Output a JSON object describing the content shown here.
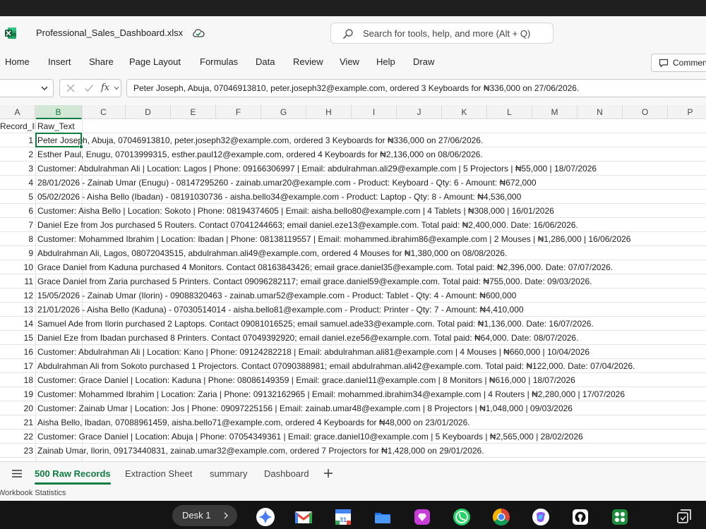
{
  "app": {
    "filename": "Professional_Sales_Dashboard.xlsx",
    "search_placeholder": "Search for tools, help, and more (Alt + Q)"
  },
  "ribbon": {
    "tabs": [
      "Home",
      "Insert",
      "Share",
      "Page Layout",
      "Formulas",
      "Data",
      "Review",
      "View",
      "Help",
      "Draw"
    ],
    "comments_label": "Comments"
  },
  "formula_bar": {
    "fx_label": "fx",
    "value": "Peter Joseph, Abuja, 07046913810, peter.joseph32@example.com, ordered 3 Keyboards for ₦336,000 on 27/06/2026."
  },
  "grid": {
    "columns": [
      "A",
      "B",
      "C",
      "D",
      "E",
      "F",
      "G",
      "H",
      "I",
      "J",
      "K",
      "L",
      "M",
      "N",
      "O",
      "P"
    ],
    "selected_column": "B",
    "active_cell": "B2",
    "header_row": {
      "a": "Record_ID",
      "b": "Raw_Text"
    },
    "rows": [
      {
        "id": "1",
        "text": "Peter Joseph, Abuja, 07046913810, peter.joseph32@example.com, ordered 3 Keyboards for ₦336,000 on 27/06/2026."
      },
      {
        "id": "2",
        "text": "Esther Paul, Enugu, 07013999315, esther.paul12@example.com, ordered 4 Keyboards for ₦2,136,000 on 08/06/2026."
      },
      {
        "id": "3",
        "text": "Customer: Abdulrahman Ali | Location: Lagos | Phone: 09166306997 | Email: abdulrahman.ali29@example.com | 5 Projectors | ₦55,000 | 18/07/2026"
      },
      {
        "id": "4",
        "text": "28/01/2026 - Zainab Umar (Enugu) - 08147295260 - zainab.umar20@example.com - Product: Keyboard - Qty: 6 - Amount: ₦672,000"
      },
      {
        "id": "5",
        "text": "05/02/2026 - Aisha Bello (Ibadan) - 08191030736 - aisha.bello34@example.com - Product: Laptop - Qty: 8 - Amount: ₦4,536,000"
      },
      {
        "id": "6",
        "text": "Customer: Aisha Bello | Location: Sokoto | Phone: 08194374605 | Email: aisha.bello80@example.com | 4 Tablets | ₦308,000 | 16/01/2026"
      },
      {
        "id": "7",
        "text": "Daniel Eze from Jos purchased 5 Routers. Contact 07041244663; email daniel.eze13@example.com. Total paid: ₦2,400,000. Date: 16/06/2026."
      },
      {
        "id": "8",
        "text": "Customer: Mohammed Ibrahim | Location: Ibadan | Phone: 08138119557 | Email: mohammed.ibrahim86@example.com | 2 Mouses | ₦1,286,000 | 16/06/2026"
      },
      {
        "id": "9",
        "text": "Abdulrahman Ali, Lagos, 08072043515, abdulrahman.ali49@example.com, ordered 4 Mouses for ₦1,380,000 on 08/08/2026."
      },
      {
        "id": "10",
        "text": "Grace Daniel from Kaduna purchased 4 Monitors. Contact 08163843426; email grace.daniel35@example.com. Total paid: ₦2,396,000. Date: 07/07/2026."
      },
      {
        "id": "11",
        "text": "Grace Daniel from Zaria purchased 5 Printers. Contact 09096282117; email grace.daniel59@example.com. Total paid: ₦755,000. Date: 09/03/2026."
      },
      {
        "id": "12",
        "text": "15/05/2026 - Zainab Umar (Ilorin) - 09088320463 - zainab.umar52@example.com - Product: Tablet - Qty: 4 - Amount: ₦600,000"
      },
      {
        "id": "13",
        "text": "21/01/2026 - Aisha Bello (Kaduna) - 07030514014 - aisha.bello81@example.com - Product: Printer - Qty: 7 - Amount: ₦4,410,000"
      },
      {
        "id": "14",
        "text": "Samuel Ade from Ilorin purchased 2 Laptops. Contact 09081016525; email samuel.ade33@example.com. Total paid: ₦1,136,000. Date: 16/07/2026."
      },
      {
        "id": "15",
        "text": "Daniel Eze from Ibadan purchased 8 Printers. Contact 07049392920; email daniel.eze56@example.com. Total paid: ₦64,000. Date: 08/07/2026."
      },
      {
        "id": "16",
        "text": "Customer: Abdulrahman Ali | Location: Kano | Phone: 09124282218 | Email: abdulrahman.ali81@example.com | 4 Mouses | ₦660,000 | 10/04/2026"
      },
      {
        "id": "17",
        "text": "Abdulrahman Ali from Sokoto purchased 1 Projectors. Contact 07090388981; email abdulrahman.ali42@example.com. Total paid: ₦122,000. Date: 07/04/2026."
      },
      {
        "id": "18",
        "text": "Customer: Grace Daniel | Location: Kaduna | Phone: 08086149359 | Email: grace.daniel11@example.com | 8 Monitors | ₦616,000 | 18/07/2026"
      },
      {
        "id": "19",
        "text": "Customer: Mohammed Ibrahim | Location: Zaria | Phone: 09132162965 | Email: mohammed.ibrahim34@example.com | 4 Routers | ₦2,280,000 | 17/07/2026"
      },
      {
        "id": "20",
        "text": "Customer: Zainab Umar | Location: Jos | Phone: 09097225156 | Email: zainab.umar48@example.com | 8 Projectors | ₦1,048,000 | 09/03/2026"
      },
      {
        "id": "21",
        "text": "Aisha Bello, Ibadan, 07088961459, aisha.bello71@example.com, ordered 4 Keyboards for ₦48,000 on 23/01/2026."
      },
      {
        "id": "22",
        "text": "Customer: Grace Daniel | Location: Abuja | Phone: 07054349361 | Email: grace.daniel10@example.com | 5 Keyboards | ₦2,565,000 | 28/02/2026"
      },
      {
        "id": "23",
        "text": "Zainab Umar, Ilorin, 09173440831, zainab.umar32@example.com, ordered 7 Projectors for ₦1,428,000 on 29/01/2026."
      }
    ]
  },
  "sheet_tabs": {
    "tabs": [
      "500 Raw Records",
      "Extraction Sheet",
      "summary",
      "Dashboard"
    ],
    "active": "500 Raw Records"
  },
  "status_bar": {
    "text": "Workbook Statistics"
  },
  "taskbar": {
    "desk_label": "Desk 1",
    "apps": [
      "gemini-icon",
      "gmail-icon",
      "calendar-icon",
      "files-icon",
      "app-icon",
      "whatsapp-icon",
      "chrome-icon",
      "copilot-icon",
      "github-icon",
      "workspace-icon",
      "screenshot-icon"
    ]
  },
  "colors": {
    "accent": "#107c41",
    "taskbar": "#141414",
    "header_bg": "#f3f3f3"
  }
}
